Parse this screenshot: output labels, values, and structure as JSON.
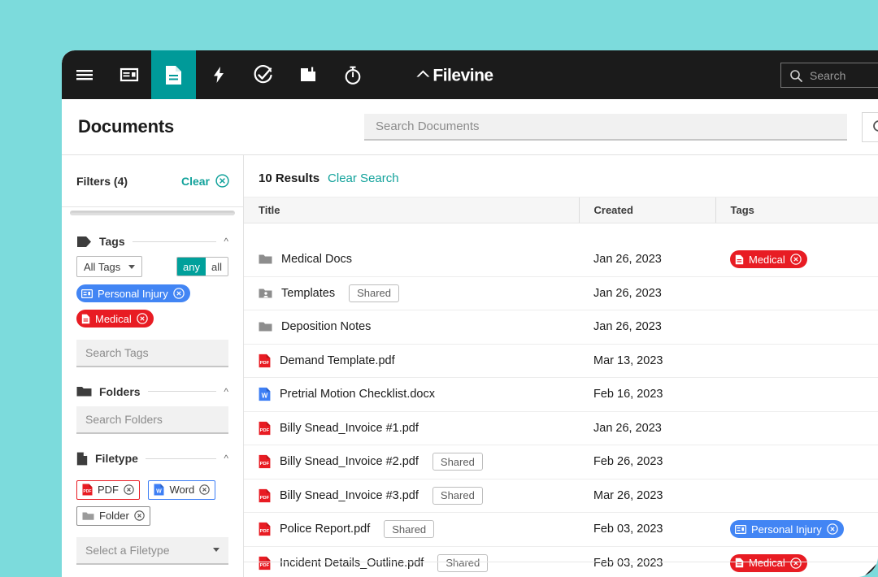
{
  "theme": {
    "backdrop": "#7cdbdc",
    "navbar_bg": "#1b1b1b",
    "accent_teal": "#009a99",
    "link_teal": "#12a29b",
    "tag_blue": "#4285f4",
    "tag_red": "#e81c23"
  },
  "topnav": {
    "items": [
      {
        "name": "menu-icon",
        "label": "Menu",
        "active": false
      },
      {
        "name": "dashboard-icon",
        "label": "Dashboard",
        "active": false
      },
      {
        "name": "documents-icon",
        "label": "Documents",
        "active": true
      },
      {
        "name": "activity-icon",
        "label": "Activity",
        "active": false
      },
      {
        "name": "tasks-icon",
        "label": "Tasks",
        "active": false
      },
      {
        "name": "briefcase-icon",
        "label": "Projects",
        "active": false
      },
      {
        "name": "timer-icon",
        "label": "Timekeeping",
        "active": false
      }
    ],
    "brand": "Filevine",
    "global_search_placeholder": "Search"
  },
  "header": {
    "title": "Documents",
    "search_placeholder": "Search Documents"
  },
  "sidebar": {
    "filters_title": "Filters (4)",
    "clear_label": "Clear",
    "sections": {
      "tags": {
        "label": "Tags",
        "select_label": "All Tags",
        "toggle": {
          "any": "any",
          "all": "all",
          "selected": "any"
        },
        "chips": [
          {
            "label": "Personal Injury",
            "color": "#4285f4",
            "icon": "id-card-icon"
          },
          {
            "label": "Medical",
            "color": "#e81c23",
            "icon": "document-icon"
          }
        ],
        "search_placeholder": "Search Tags"
      },
      "folders": {
        "label": "Folders",
        "search_placeholder": "Search Folders"
      },
      "filetype": {
        "label": "Filetype",
        "chips": [
          {
            "label": "PDF",
            "kind": "pdf"
          },
          {
            "label": "Word",
            "kind": "word"
          },
          {
            "label": "Folder",
            "kind": "folder"
          }
        ],
        "select_placeholder": "Select a Filetype"
      }
    }
  },
  "results": {
    "count_label": "10 Results",
    "clear_search_label": "Clear Search",
    "columns": [
      "Title",
      "Created",
      "Tags"
    ],
    "rows": [
      {
        "title": "Medical Docs",
        "type": "folder",
        "shared": false,
        "created": "Jan 26, 2023",
        "tags": [
          {
            "label": "Medical",
            "color": "#e81c23",
            "icon": "document-icon"
          }
        ]
      },
      {
        "title": "Templates",
        "type": "shared-folder",
        "shared": true,
        "created": "Jan 26, 2023",
        "tags": []
      },
      {
        "title": "Deposition Notes",
        "type": "folder",
        "shared": false,
        "created": "Jan 26, 2023",
        "tags": []
      },
      {
        "title": "Demand Template.pdf",
        "type": "pdf",
        "shared": false,
        "created": "Mar 13, 2023",
        "tags": []
      },
      {
        "title": "Pretrial Motion Checklist.docx",
        "type": "word",
        "shared": false,
        "created": "Feb 16, 2023",
        "tags": []
      },
      {
        "title": "Billy Snead_Invoice #1.pdf",
        "type": "pdf",
        "shared": false,
        "created": "Jan 26, 2023",
        "tags": []
      },
      {
        "title": "Billy Snead_Invoice #2.pdf",
        "type": "pdf",
        "shared": true,
        "created": "Feb 26, 2023",
        "tags": []
      },
      {
        "title": "Billy Snead_Invoice #3.pdf",
        "type": "pdf",
        "shared": true,
        "created": "Mar 26, 2023",
        "tags": []
      },
      {
        "title": "Police Report.pdf",
        "type": "pdf",
        "shared": true,
        "created": "Feb 03, 2023",
        "tags": [
          {
            "label": "Personal Injury",
            "color": "#4285f4",
            "icon": "id-card-icon"
          }
        ]
      },
      {
        "title": "Incident Details_Outline.pdf",
        "type": "pdf",
        "shared": true,
        "created": "Feb 03, 2023",
        "tags": [
          {
            "label": "Medical",
            "color": "#e81c23",
            "icon": "document-icon"
          }
        ]
      }
    ],
    "shared_badge_label": "Shared"
  }
}
